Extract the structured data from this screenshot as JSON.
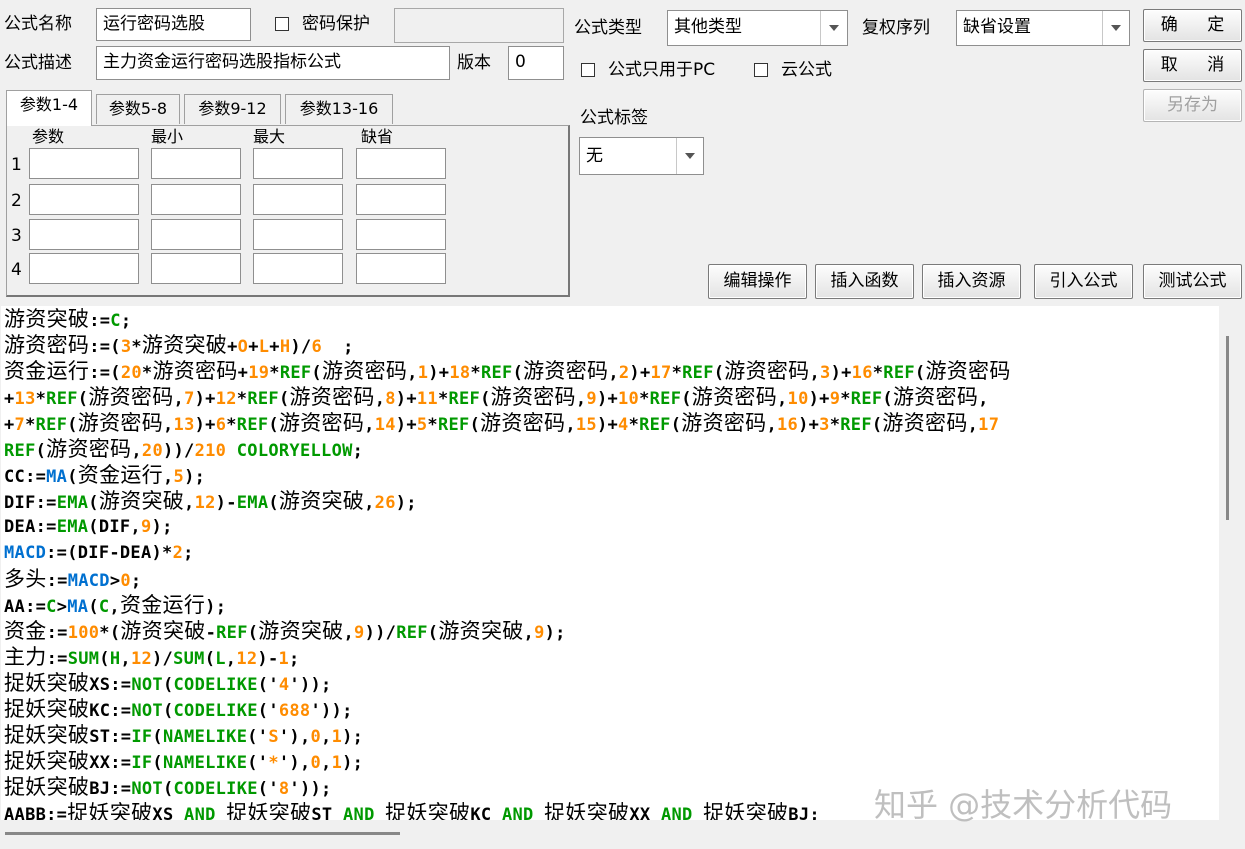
{
  "form": {
    "name_label": "公式名称",
    "name_value": "运行密码选股",
    "password_protect_label": "密码保护",
    "password_value": "",
    "desc_label": "公式描述",
    "desc_value": "主力资金运行密码选股指标公式",
    "version_label": "版本",
    "version_value": "0",
    "type_label": "公式类型",
    "type_value": "其他类型",
    "rights_label": "复权序列",
    "rights_value": "缺省设置",
    "pc_only_label": "公式只用于PC",
    "cloud_label": "云公式",
    "tag_label": "公式标签",
    "tag_value": "无"
  },
  "buttons": {
    "ok": "确 定",
    "cancel": "取 消",
    "save_as": "另存为",
    "edit_ops": "编辑操作",
    "insert_func": "插入函数",
    "insert_res": "插入资源",
    "import_formula": "引入公式",
    "test_formula": "测试公式"
  },
  "params": {
    "tabs": [
      "参数1-4",
      "参数5-8",
      "参数9-12",
      "参数13-16"
    ],
    "active_tab": 0,
    "headers": [
      "参数",
      "最小",
      "最大",
      "缺省"
    ],
    "rows": [
      "1",
      "2",
      "3",
      "4"
    ]
  },
  "code_lines": [
    [
      [
        "cjk",
        "游资突破"
      ],
      [
        "p",
        ":="
      ],
      [
        "g",
        "C"
      ],
      [
        "p",
        ";"
      ]
    ],
    [
      [
        "cjk",
        "游资密码"
      ],
      [
        "p",
        ":=("
      ],
      [
        "n",
        "3"
      ],
      [
        "p",
        "*"
      ],
      [
        "cjk",
        "游资突破"
      ],
      [
        "p",
        "+"
      ],
      [
        "n",
        "O"
      ],
      [
        "p",
        "+"
      ],
      [
        "n",
        "L"
      ],
      [
        "p",
        "+"
      ],
      [
        "n",
        "H"
      ],
      [
        "p",
        ")/"
      ],
      [
        "n",
        "6"
      ],
      [
        "p",
        "  ;"
      ]
    ],
    [
      [
        "cjk",
        "资金运行"
      ],
      [
        "p",
        ":=("
      ],
      [
        "n",
        "20"
      ],
      [
        "p",
        "*"
      ],
      [
        "cjk",
        "游资密码"
      ],
      [
        "p",
        "+"
      ],
      [
        "n",
        "19"
      ],
      [
        "p",
        "*"
      ],
      [
        "g",
        "REF"
      ],
      [
        "p",
        "("
      ],
      [
        "cjk",
        "游资密码"
      ],
      [
        "p",
        ","
      ],
      [
        "n",
        "1"
      ],
      [
        "p",
        ")+"
      ],
      [
        "n",
        "18"
      ],
      [
        "p",
        "*"
      ],
      [
        "g",
        "REF"
      ],
      [
        "p",
        "("
      ],
      [
        "cjk",
        "游资密码"
      ],
      [
        "p",
        ","
      ],
      [
        "n",
        "2"
      ],
      [
        "p",
        ")+"
      ],
      [
        "n",
        "17"
      ],
      [
        "p",
        "*"
      ],
      [
        "g",
        "REF"
      ],
      [
        "p",
        "("
      ],
      [
        "cjk",
        "游资密码"
      ],
      [
        "p",
        ","
      ],
      [
        "n",
        "3"
      ],
      [
        "p",
        ")+"
      ],
      [
        "n",
        "16"
      ],
      [
        "p",
        "*"
      ],
      [
        "g",
        "REF"
      ],
      [
        "p",
        "("
      ],
      [
        "cjk",
        "游资密码"
      ]
    ],
    [
      [
        "p",
        "+"
      ],
      [
        "n",
        "13"
      ],
      [
        "p",
        "*"
      ],
      [
        "g",
        "REF"
      ],
      [
        "p",
        "("
      ],
      [
        "cjk",
        "游资密码"
      ],
      [
        "p",
        ","
      ],
      [
        "n",
        "7"
      ],
      [
        "p",
        ")+"
      ],
      [
        "n",
        "12"
      ],
      [
        "p",
        "*"
      ],
      [
        "g",
        "REF"
      ],
      [
        "p",
        "("
      ],
      [
        "cjk",
        "游资密码"
      ],
      [
        "p",
        ","
      ],
      [
        "n",
        "8"
      ],
      [
        "p",
        ")+"
      ],
      [
        "n",
        "11"
      ],
      [
        "p",
        "*"
      ],
      [
        "g",
        "REF"
      ],
      [
        "p",
        "("
      ],
      [
        "cjk",
        "游资密码"
      ],
      [
        "p",
        ","
      ],
      [
        "n",
        "9"
      ],
      [
        "p",
        ")+"
      ],
      [
        "n",
        "10"
      ],
      [
        "p",
        "*"
      ],
      [
        "g",
        "REF"
      ],
      [
        "p",
        "("
      ],
      [
        "cjk",
        "游资密码"
      ],
      [
        "p",
        ","
      ],
      [
        "n",
        "10"
      ],
      [
        "p",
        ")+"
      ],
      [
        "n",
        "9"
      ],
      [
        "p",
        "*"
      ],
      [
        "g",
        "REF"
      ],
      [
        "p",
        "("
      ],
      [
        "cjk",
        "游资密码"
      ],
      [
        "p",
        ","
      ]
    ],
    [
      [
        "p",
        "+"
      ],
      [
        "n",
        "7"
      ],
      [
        "p",
        "*"
      ],
      [
        "g",
        "REF"
      ],
      [
        "p",
        "("
      ],
      [
        "cjk",
        "游资密码"
      ],
      [
        "p",
        ","
      ],
      [
        "n",
        "13"
      ],
      [
        "p",
        ")+"
      ],
      [
        "n",
        "6"
      ],
      [
        "p",
        "*"
      ],
      [
        "g",
        "REF"
      ],
      [
        "p",
        "("
      ],
      [
        "cjk",
        "游资密码"
      ],
      [
        "p",
        ","
      ],
      [
        "n",
        "14"
      ],
      [
        "p",
        ")+"
      ],
      [
        "n",
        "5"
      ],
      [
        "p",
        "*"
      ],
      [
        "g",
        "REF"
      ],
      [
        "p",
        "("
      ],
      [
        "cjk",
        "游资密码"
      ],
      [
        "p",
        ","
      ],
      [
        "n",
        "15"
      ],
      [
        "p",
        ")+"
      ],
      [
        "n",
        "4"
      ],
      [
        "p",
        "*"
      ],
      [
        "g",
        "REF"
      ],
      [
        "p",
        "("
      ],
      [
        "cjk",
        "游资密码"
      ],
      [
        "p",
        ","
      ],
      [
        "n",
        "16"
      ],
      [
        "p",
        ")+"
      ],
      [
        "n",
        "3"
      ],
      [
        "p",
        "*"
      ],
      [
        "g",
        "REF"
      ],
      [
        "p",
        "("
      ],
      [
        "cjk",
        "游资密码"
      ],
      [
        "p",
        ","
      ],
      [
        "n",
        "17"
      ]
    ],
    [
      [
        "g",
        "REF"
      ],
      [
        "p",
        "("
      ],
      [
        "cjk",
        "游资密码"
      ],
      [
        "p",
        ","
      ],
      [
        "n",
        "20"
      ],
      [
        "p",
        "))/"
      ],
      [
        "n",
        "210"
      ],
      [
        "p",
        " "
      ],
      [
        "g",
        "COLORYELLOW"
      ],
      [
        "p",
        ";"
      ]
    ],
    [
      [
        "p",
        "CC:="
      ],
      [
        "b",
        "MA"
      ],
      [
        "p",
        "("
      ],
      [
        "cjk",
        "资金运行"
      ],
      [
        "p",
        ","
      ],
      [
        "n",
        "5"
      ],
      [
        "p",
        ");"
      ]
    ],
    [
      [
        "p",
        "DIF:="
      ],
      [
        "g",
        "EMA"
      ],
      [
        "p",
        "("
      ],
      [
        "cjk",
        "游资突破"
      ],
      [
        "p",
        ","
      ],
      [
        "n",
        "12"
      ],
      [
        "p",
        ")-"
      ],
      [
        "g",
        "EMA"
      ],
      [
        "p",
        "("
      ],
      [
        "cjk",
        "游资突破"
      ],
      [
        "p",
        ","
      ],
      [
        "n",
        "26"
      ],
      [
        "p",
        ");"
      ]
    ],
    [
      [
        "p",
        "DEA:="
      ],
      [
        "g",
        "EMA"
      ],
      [
        "p",
        "(DIF,"
      ],
      [
        "n",
        "9"
      ],
      [
        "p",
        ");"
      ]
    ],
    [
      [
        "b",
        "MACD"
      ],
      [
        "p",
        ":=(DIF-DEA)*"
      ],
      [
        "n",
        "2"
      ],
      [
        "p",
        ";"
      ]
    ],
    [
      [
        "cjk",
        "多头"
      ],
      [
        "p",
        ":="
      ],
      [
        "b",
        "MACD"
      ],
      [
        "p",
        ">"
      ],
      [
        "n",
        "0"
      ],
      [
        "p",
        ";"
      ]
    ],
    [
      [
        "p",
        "AA:="
      ],
      [
        "g",
        "C"
      ],
      [
        "p",
        ">"
      ],
      [
        "b",
        "MA"
      ],
      [
        "p",
        "("
      ],
      [
        "g",
        "C"
      ],
      [
        "p",
        ","
      ],
      [
        "cjk",
        "资金运行"
      ],
      [
        "p",
        ");"
      ]
    ],
    [
      [
        "cjk",
        "资金"
      ],
      [
        "p",
        ":="
      ],
      [
        "n",
        "100"
      ],
      [
        "p",
        "*("
      ],
      [
        "cjk",
        "游资突破"
      ],
      [
        "p",
        "-"
      ],
      [
        "g",
        "REF"
      ],
      [
        "p",
        "("
      ],
      [
        "cjk",
        "游资突破"
      ],
      [
        "p",
        ","
      ],
      [
        "n",
        "9"
      ],
      [
        "p",
        "))/"
      ],
      [
        "g",
        "REF"
      ],
      [
        "p",
        "("
      ],
      [
        "cjk",
        "游资突破"
      ],
      [
        "p",
        ","
      ],
      [
        "n",
        "9"
      ],
      [
        "p",
        ");"
      ]
    ],
    [
      [
        "cjk",
        "主力"
      ],
      [
        "p",
        ":="
      ],
      [
        "g",
        "SUM"
      ],
      [
        "p",
        "("
      ],
      [
        "g",
        "H"
      ],
      [
        "p",
        ","
      ],
      [
        "n",
        "12"
      ],
      [
        "p",
        ")/"
      ],
      [
        "g",
        "SUM"
      ],
      [
        "p",
        "("
      ],
      [
        "g",
        "L"
      ],
      [
        "p",
        ","
      ],
      [
        "n",
        "12"
      ],
      [
        "p",
        ")-"
      ],
      [
        "n",
        "1"
      ],
      [
        "p",
        ";"
      ]
    ],
    [
      [
        "cjk",
        "捉妖突破"
      ],
      [
        "p",
        "XS:="
      ],
      [
        "g",
        "NOT"
      ],
      [
        "p",
        "("
      ],
      [
        "g",
        "CODELIKE"
      ],
      [
        "p",
        "('"
      ],
      [
        "n",
        "4"
      ],
      [
        "p",
        "'));"
      ]
    ],
    [
      [
        "cjk",
        "捉妖突破"
      ],
      [
        "p",
        "KC:="
      ],
      [
        "g",
        "NOT"
      ],
      [
        "p",
        "("
      ],
      [
        "g",
        "CODELIKE"
      ],
      [
        "p",
        "('"
      ],
      [
        "n",
        "688"
      ],
      [
        "p",
        "'));"
      ]
    ],
    [
      [
        "cjk",
        "捉妖突破"
      ],
      [
        "p",
        "ST:="
      ],
      [
        "g",
        "IF"
      ],
      [
        "p",
        "("
      ],
      [
        "g",
        "NAMELIKE"
      ],
      [
        "p",
        "('"
      ],
      [
        "n",
        "S"
      ],
      [
        "p",
        "'),"
      ],
      [
        "n",
        "0"
      ],
      [
        "p",
        ","
      ],
      [
        "n",
        "1"
      ],
      [
        "p",
        ");"
      ]
    ],
    [
      [
        "cjk",
        "捉妖突破"
      ],
      [
        "p",
        "XX:="
      ],
      [
        "g",
        "IF"
      ],
      [
        "p",
        "("
      ],
      [
        "g",
        "NAMELIKE"
      ],
      [
        "p",
        "('"
      ],
      [
        "n",
        "*"
      ],
      [
        "p",
        "'),"
      ],
      [
        "n",
        "0"
      ],
      [
        "p",
        ","
      ],
      [
        "n",
        "1"
      ],
      [
        "p",
        ");"
      ]
    ],
    [
      [
        "cjk",
        "捉妖突破"
      ],
      [
        "p",
        "BJ:="
      ],
      [
        "g",
        "NOT"
      ],
      [
        "p",
        "("
      ],
      [
        "g",
        "CODELIKE"
      ],
      [
        "p",
        "('"
      ],
      [
        "n",
        "8"
      ],
      [
        "p",
        "'));"
      ]
    ],
    [
      [
        "p",
        "AABB:="
      ],
      [
        "cjk",
        "捉妖突破"
      ],
      [
        "p",
        "XS "
      ],
      [
        "g",
        "AND"
      ],
      [
        "p",
        " "
      ],
      [
        "cjk",
        "捉妖突破"
      ],
      [
        "p",
        "ST "
      ],
      [
        "g",
        "AND"
      ],
      [
        "p",
        " "
      ],
      [
        "cjk",
        "捉妖突破"
      ],
      [
        "p",
        "KC "
      ],
      [
        "g",
        "AND"
      ],
      [
        "p",
        " "
      ],
      [
        "cjk",
        "捉妖突破"
      ],
      [
        "p",
        "XX "
      ],
      [
        "g",
        "AND"
      ],
      [
        "p",
        " "
      ],
      [
        "cjk",
        "捉妖突破"
      ],
      [
        "p",
        "BJ;"
      ]
    ]
  ],
  "watermark": "知乎 @技术分析代码",
  "colors": {
    "keyword_green": "#009900",
    "number_orange": "#ff8c00",
    "func_blue": "#0070d0"
  }
}
